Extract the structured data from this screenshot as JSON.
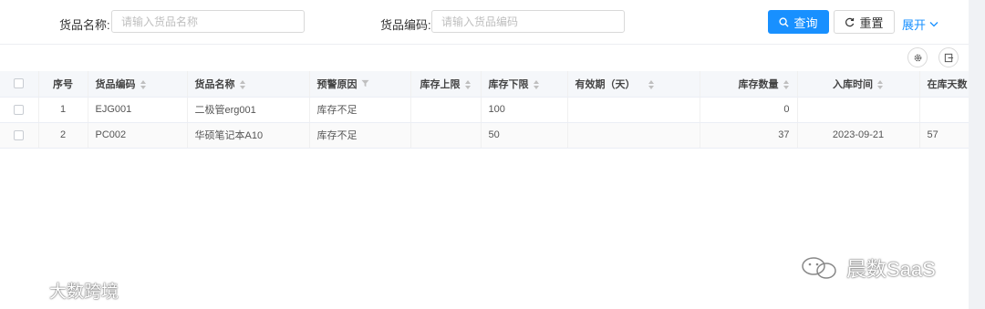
{
  "search": {
    "name_label": "货品名称:",
    "name_placeholder": "请输入货品名称",
    "code_label": "货品编码:",
    "code_placeholder": "请输入货品编码",
    "query_label": "查询",
    "reset_label": "重置",
    "expand_label": "展开"
  },
  "colors": {
    "primary": "#1890ff",
    "header_bg": "#f5f7fa"
  },
  "table": {
    "columns": [
      "序号",
      "货品编码",
      "货品名称",
      "预警原因",
      "库存上限",
      "库存下限",
      "有效期（天）",
      "库存数量",
      "入库时间",
      "在库天数"
    ],
    "rows": [
      [
        "1",
        "EJG001",
        "二极管erg001",
        "库存不足",
        "",
        "100",
        "",
        "0",
        "",
        ""
      ],
      [
        "2",
        "PC002",
        "华硕笔记本A10",
        "库存不足",
        "",
        "50",
        "",
        "37",
        "2023-09-21",
        "57"
      ]
    ]
  },
  "watermarks": {
    "left": "大数跨境",
    "right": "晨数SaaS"
  }
}
